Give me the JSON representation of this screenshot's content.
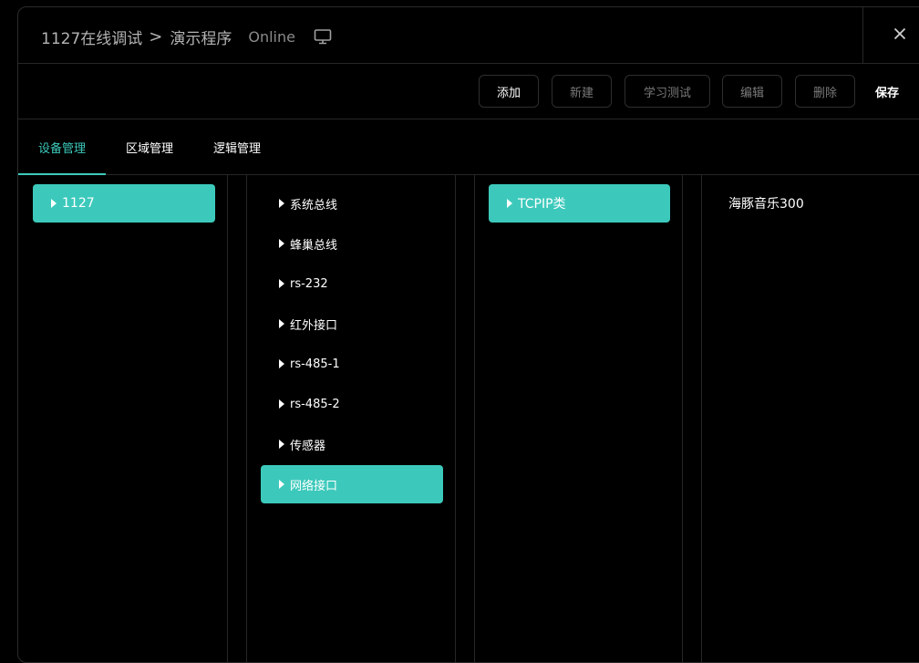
{
  "title": {
    "project": "1127在线调试",
    "separator": ">",
    "program": "演示程序",
    "status": "Online",
    "monitor_icon": "monitor-icon",
    "close_icon": "close-icon"
  },
  "toolbar": {
    "add_label": "添加",
    "new_label": "新建",
    "learn_test_label": "学习测试",
    "edit_label": "编辑",
    "delete_label": "删除",
    "save_label": "保存"
  },
  "tabs": [
    {
      "label": "设备管理",
      "active": true
    },
    {
      "label": "区域管理",
      "active": false
    },
    {
      "label": "逻辑管理",
      "active": false
    }
  ],
  "columns": {
    "col1": [
      {
        "label": "1127",
        "selected": true
      }
    ],
    "col2": [
      {
        "label": "系统总线",
        "selected": false
      },
      {
        "label": "蜂巢总线",
        "selected": false
      },
      {
        "label": "rs-232",
        "selected": false
      },
      {
        "label": "红外接口",
        "selected": false
      },
      {
        "label": "rs-485-1",
        "selected": false
      },
      {
        "label": "rs-485-2",
        "selected": false
      },
      {
        "label": "传感器",
        "selected": false
      },
      {
        "label": "网络接口",
        "selected": true
      }
    ],
    "col3": [
      {
        "label": "TCPIP类",
        "selected": true
      }
    ],
    "col4": [
      {
        "label": "海豚音乐300"
      }
    ]
  },
  "colors": {
    "accent": "#3cc9bb",
    "background": "#000000",
    "border": "#262626"
  }
}
